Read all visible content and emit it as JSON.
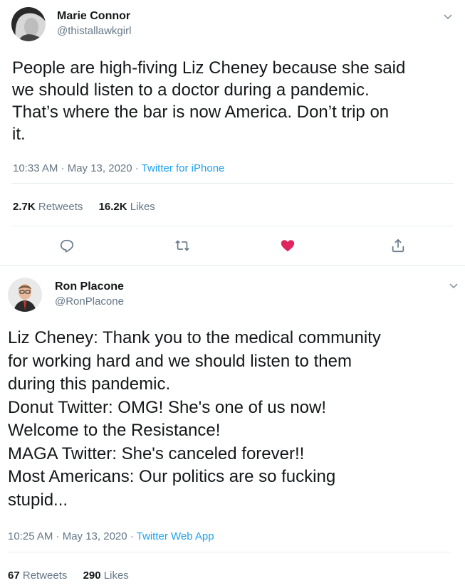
{
  "tweets": [
    {
      "name": "Marie Connor",
      "handle": "@thistallawkgirl",
      "text": "People are high-fiving Liz Cheney because she said\nwe should listen to a doctor during a pandemic.\nThat’s where the bar is now America. Don’t trip on\nit.",
      "time": "10:33 AM · May 13, 2020 · ",
      "source": "Twitter for iPhone",
      "retweets": "2.7K",
      "retweets_label": "Retweets",
      "likes": "16.2K",
      "likes_label": "Likes"
    },
    {
      "name": "Ron Placone",
      "handle": "@RonPlacone",
      "text": "Liz Cheney: Thank you to the medical community\nfor working hard and we should listen to them\nduring this pandemic.\nDonut Twitter: OMG! She's one of us now!\nWelcome to the Resistance!\nMAGA Twitter: She's canceled forever!!\nMost Americans: Our politics are so fucking\nstupid...",
      "time": "10:25 AM · May 13, 2020 · ",
      "source": "Twitter Web App",
      "retweets": "67",
      "retweets_label": "Retweets",
      "likes": "290",
      "likes_label": "Likes"
    }
  ],
  "actions": {
    "reply": "reply-icon",
    "retweet": "retweet-icon",
    "like": "heart-icon",
    "share": "share-icon"
  },
  "colors": {
    "link": "#1da1f2",
    "like": "#e0245e",
    "muted": "#657786",
    "divider": "#e6ecf0"
  }
}
